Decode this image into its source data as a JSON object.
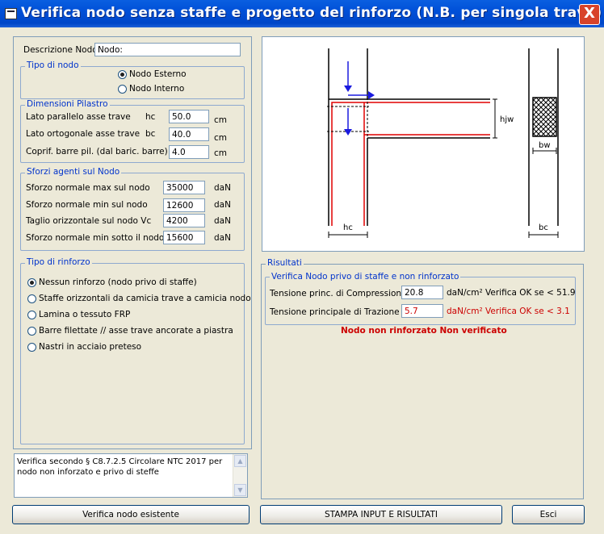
{
  "window": {
    "title": "Verifica nodo senza staffe e progetto del rinforzo (N.B.  per singola  trave)",
    "close_label": "X"
  },
  "descrizione": {
    "label": "Descrizione Nodo",
    "value": "Nodo:"
  },
  "tipo_nodo": {
    "legend": "Tipo di nodo",
    "options": [
      "Nodo Esterno",
      "Nodo Interno"
    ],
    "selected": "Nodo Esterno"
  },
  "dimensioni": {
    "legend": "Dimensioni Pilastro",
    "rows": [
      {
        "label": "Lato  parallelo asse trave",
        "sym": "hc",
        "value": "50.0",
        "unit": "cm"
      },
      {
        "label": "Lato  ortogonale asse trave",
        "sym": "bc",
        "value": "40.0",
        "unit": "cm"
      },
      {
        "label": "Coprif. barre pil. (dal baric. barre)",
        "sym": "",
        "value": "4.0",
        "unit": "cm"
      }
    ]
  },
  "sforzi": {
    "legend": "Sforzi agenti sul Nodo",
    "rows": [
      {
        "label": "Sforzo normale max sul nodo",
        "value": "35000",
        "unit": "daN"
      },
      {
        "label": "Sforzo normale min sul nodo",
        "value": "12600",
        "unit": "daN"
      },
      {
        "label": "Taglio orizzontale sul nodo Vc",
        "value": "4200",
        "unit": "daN"
      },
      {
        "label": "Sforzo normale min sotto il nodo",
        "value": "15600",
        "unit": "daN"
      }
    ]
  },
  "rinforzo": {
    "legend": "Tipo di rinforzo",
    "options": [
      "Nessun rinforzo (nodo privo di staffe)",
      "Staffe orizzontali  da camicia trave a camicia nodo",
      "Lamina o tessuto FRP",
      "Barre filettate // asse trave ancorate a piastra",
      "Nastri in acciaio preteso"
    ],
    "selected": "Nessun rinforzo (nodo privo di staffe)"
  },
  "note": "Verifica secondo § C8.7.2.5 Circolare NTC 2017 per nodo non inforzato e privo di steffe",
  "figure": {
    "labels": {
      "hjw": "hjw",
      "hc": "hc",
      "bw": "bw",
      "bc": "bc"
    },
    "colors": {
      "line": "#000000",
      "rebar": "#e00000",
      "arrow": "#1a1adf"
    }
  },
  "risultati": {
    "legend": "Risultati",
    "sub_legend": "Verifica Nodo privo di staffe e non rinforzato",
    "compressione": {
      "label": "Tensione princ. di Compressione",
      "value": "20.8",
      "note": "daN/cm² Verifica OK se < 51.9"
    },
    "trazione": {
      "label": "Tensione  principale di Trazione",
      "value": "5.7",
      "note": "daN/cm²  Verifica OK se < 3.1"
    },
    "esito": "Nodo non rinforzato Non verificato"
  },
  "buttons": {
    "verifica": "Verifica nodo esistente",
    "stampa": "STAMPA  INPUT  E  RISULTATI",
    "esci": "Esci"
  }
}
